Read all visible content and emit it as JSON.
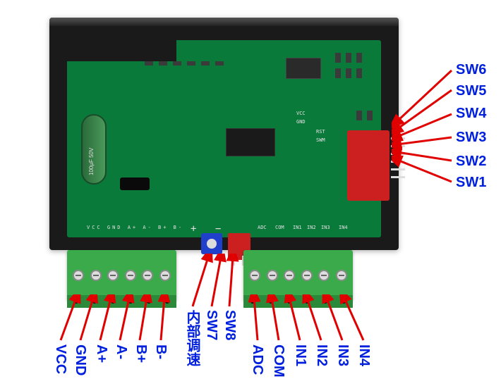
{
  "board": {
    "capacitor_rating": "100μF 50V",
    "silkscreen": {
      "vcc": "VCC",
      "gnd": "GND",
      "rst": "RST",
      "swm": "SWM",
      "adc": "ADC",
      "com": "COM",
      "in1": "IN1",
      "in2": "IN2",
      "in3": "IN3",
      "in4": "IN4",
      "plus": "+",
      "minus": "−",
      "left_row": "VCC GND A+ A- B+ B-"
    }
  },
  "right_switches": [
    "SW6",
    "SW5",
    "SW4",
    "SW3",
    "SW2",
    "SW1"
  ],
  "bottom_left": [
    "VCC",
    "GND",
    "A+",
    "A-",
    "B+",
    "B-"
  ],
  "center_labels": [
    "内部调速",
    "SW7",
    "SW8"
  ],
  "bottom_right": [
    "ADC",
    "COM",
    "IN1",
    "IN2",
    "IN3",
    "IN4"
  ]
}
